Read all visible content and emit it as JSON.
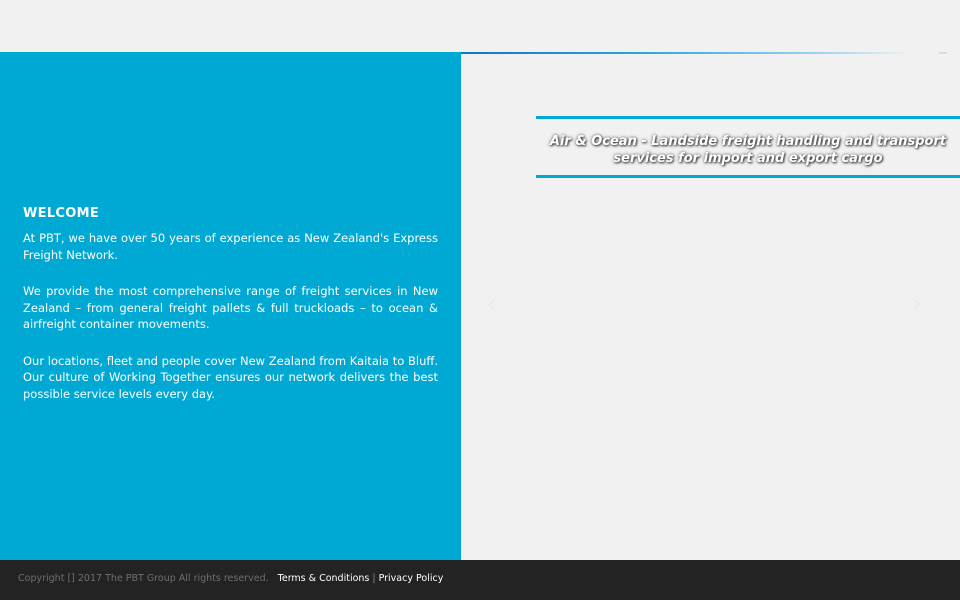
{
  "welcome": {
    "heading": "WELCOME",
    "paragraphs": [
      "At PBT, we have over 50 years of experience as New Zealand's Express Freight Network.",
      "We provide the most comprehensive range of freight services in New Zealand – from general freight pallets & full truckloads – to ocean & airfreight container movements.",
      "Our locations, fleet and people cover New Zealand from Kaitaia to Bluff. Our culture of Working Together ensures our network delivers the best possible service levels every day."
    ]
  },
  "slider": {
    "caption": "Air & Ocean - Landside freight handling and transport services for import and export cargo",
    "prev_glyph": "‹",
    "next_glyph": "›"
  },
  "footer": {
    "copyright": "Copyright [] 2017 The PBT Group   All rights reserved.",
    "terms_label": "Terms & Conditions",
    "separator": "|",
    "privacy_label": "Privacy Policy"
  },
  "colors": {
    "accent": "#00a9d4",
    "footer_bg": "#232323",
    "page_bg": "#f1f1f1"
  }
}
